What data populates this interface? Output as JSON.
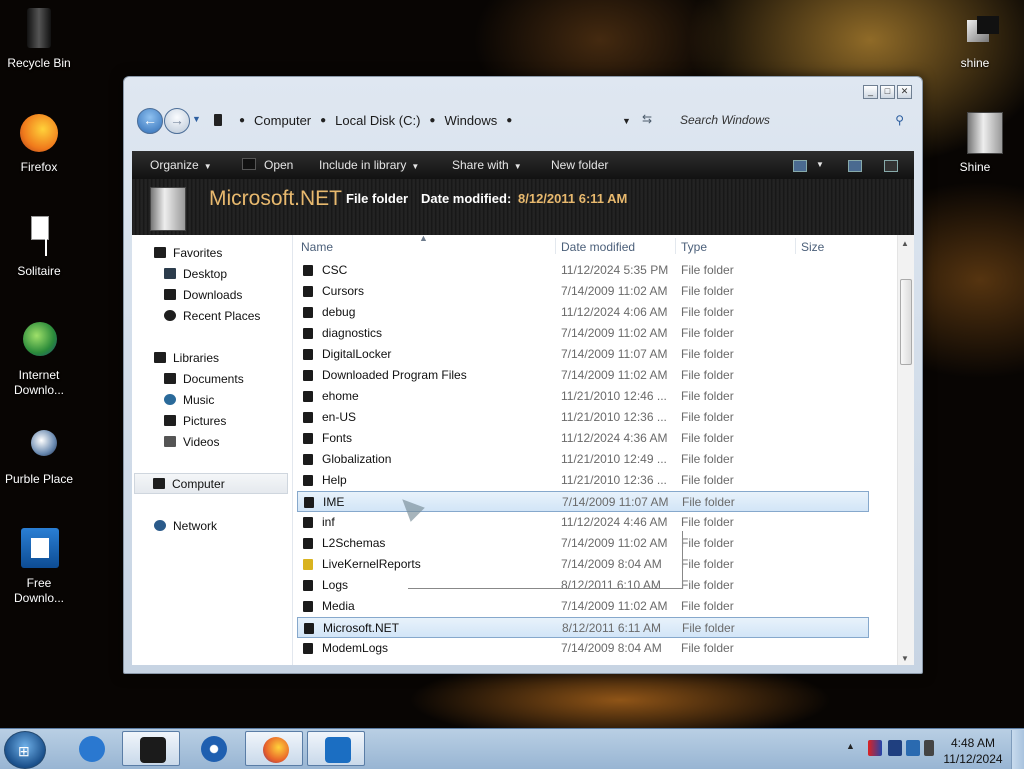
{
  "desktop": {
    "left_icons": [
      {
        "label": "Recycle Bin",
        "icon": "recycle-bin-icon"
      },
      {
        "label": "Firefox",
        "icon": "firefox-icon"
      },
      {
        "label": "Solitaire",
        "icon": "solitaire-icon"
      },
      {
        "label": "Internet Downlo...",
        "icon": "internet-download-icon"
      },
      {
        "label": "Purble Place",
        "icon": "purble-place-icon"
      },
      {
        "label": "Free Downlo...",
        "icon": "free-download-icon"
      }
    ],
    "right_icons": [
      {
        "label": "shine",
        "icon": "shine-icon"
      },
      {
        "label": "Shine",
        "icon": "shine-document-icon"
      }
    ]
  },
  "window": {
    "address": {
      "crumbs": [
        "Computer",
        "Local Disk (C:)",
        "Windows"
      ],
      "search_placeholder": "Search Windows"
    },
    "toolbar": {
      "organize": "Organize",
      "open": "Open",
      "include_in_library": "Include in library",
      "share_with": "Share with",
      "new_folder": "New folder"
    },
    "details": {
      "name": "Microsoft.NET",
      "type": "File folder",
      "date_modified_label": "Date modified:",
      "date_modified_value": "8/12/2011 6:11 AM"
    },
    "nav": {
      "favorites": "Favorites",
      "desktop": "Desktop",
      "downloads": "Downloads",
      "recent_places": "Recent Places",
      "libraries": "Libraries",
      "documents": "Documents",
      "music": "Music",
      "pictures": "Pictures",
      "videos": "Videos",
      "computer": "Computer",
      "network": "Network"
    },
    "columns": {
      "name": "Name",
      "date_modified": "Date modified",
      "type": "Type",
      "size": "Size"
    },
    "files": [
      {
        "name": "CSC",
        "date": "11/12/2024 5:35 PM",
        "type": "File folder"
      },
      {
        "name": "Cursors",
        "date": "7/14/2009 11:02 AM",
        "type": "File folder"
      },
      {
        "name": "debug",
        "date": "11/12/2024 4:06 AM",
        "type": "File folder"
      },
      {
        "name": "diagnostics",
        "date": "7/14/2009 11:02 AM",
        "type": "File folder"
      },
      {
        "name": "DigitalLocker",
        "date": "7/14/2009 11:07 AM",
        "type": "File folder"
      },
      {
        "name": "Downloaded Program Files",
        "date": "7/14/2009 11:02 AM",
        "type": "File folder"
      },
      {
        "name": "ehome",
        "date": "11/21/2010 12:46 ...",
        "type": "File folder"
      },
      {
        "name": "en-US",
        "date": "11/21/2010 12:36 ...",
        "type": "File folder"
      },
      {
        "name": "Fonts",
        "date": "11/12/2024 4:36 AM",
        "type": "File folder"
      },
      {
        "name": "Globalization",
        "date": "11/21/2010 12:49 ...",
        "type": "File folder"
      },
      {
        "name": "Help",
        "date": "11/21/2010 12:36 ...",
        "type": "File folder"
      },
      {
        "name": "IME",
        "date": "7/14/2009 11:07 AM",
        "type": "File folder"
      },
      {
        "name": "inf",
        "date": "11/12/2024 4:46 AM",
        "type": "File folder"
      },
      {
        "name": "L2Schemas",
        "date": "7/14/2009 11:02 AM",
        "type": "File folder"
      },
      {
        "name": "LiveKernelReports",
        "date": "7/14/2009 8:04 AM",
        "type": "File folder"
      },
      {
        "name": "Logs",
        "date": "8/12/2011 6:10 AM",
        "type": "File folder"
      },
      {
        "name": "Media",
        "date": "7/14/2009 11:02 AM",
        "type": "File folder"
      },
      {
        "name": "Microsoft.NET",
        "date": "8/12/2011 6:11 AM",
        "type": "File folder"
      },
      {
        "name": "ModemLogs",
        "date": "7/14/2009 8:04 AM",
        "type": "File folder"
      }
    ]
  },
  "taskbar": {
    "apps": [
      {
        "icon": "internet-explorer-icon",
        "color": "#2a78d0"
      },
      {
        "icon": "windows-explorer-icon",
        "color": "#1b1b1b"
      },
      {
        "icon": "media-player-icon",
        "color": "#1f5fb0"
      },
      {
        "icon": "firefox-icon",
        "color": "#e8622a"
      },
      {
        "icon": "free-download-manager-icon",
        "color": "#1b6ec2"
      }
    ],
    "clock_time": "4:48 AM",
    "clock_date": "11/12/2024"
  },
  "colors": {
    "accent": "#e8b96e",
    "selection": "#d2e5f7"
  }
}
